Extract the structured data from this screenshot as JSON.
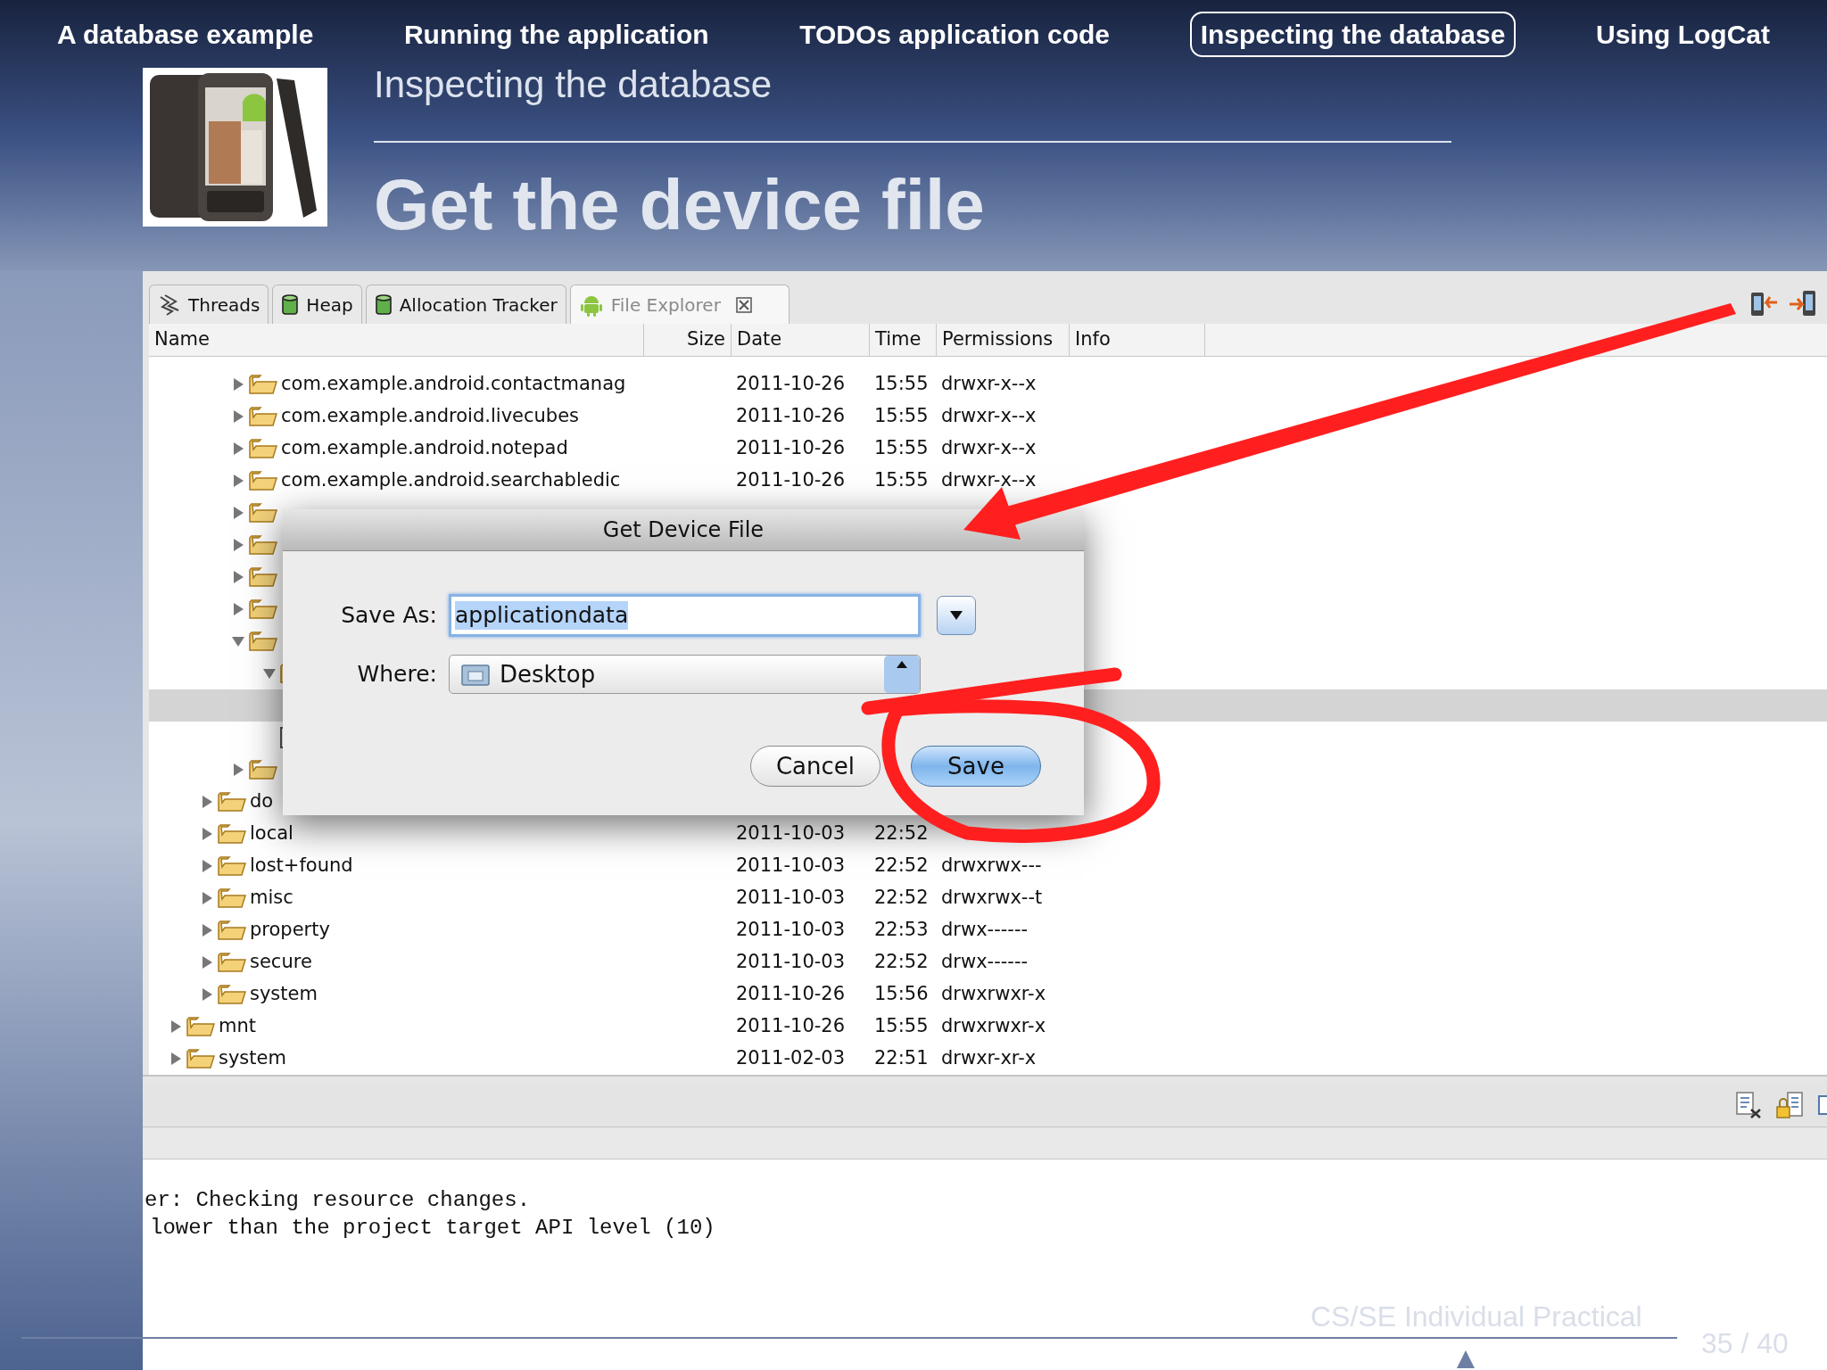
{
  "nav": [
    {
      "label": "A database example",
      "selected": false
    },
    {
      "label": "Running the application",
      "selected": false
    },
    {
      "label": "TODOs application code",
      "selected": false
    },
    {
      "label": "Inspecting the database",
      "selected": true
    },
    {
      "label": "Using LogCat",
      "selected": false
    }
  ],
  "section_title": "Inspecting the database",
  "slide_title": "Get the device file",
  "panel_tabs": [
    {
      "label": "Threads",
      "kind": "threads",
      "selected": false
    },
    {
      "label": "Heap",
      "kind": "heap",
      "selected": false
    },
    {
      "label": "Allocation Tracker",
      "kind": "heap",
      "selected": false
    },
    {
      "label": "File Explorer",
      "kind": "android",
      "selected": true
    }
  ],
  "file_table": {
    "columns": [
      "Name",
      "Size",
      "Date",
      "Time",
      "Permissions",
      "Info"
    ],
    "tree": [
      {
        "children": [
          {
            "children": [
              {
                "name": "com.example.android.contactmanag",
                "date": "2011-10-26",
                "time": "15:55",
                "permissions": "drwxr-x--x",
                "expanded": false,
                "selected": false
              },
              {
                "name": "com.example.android.livecubes",
                "date": "2011-10-26",
                "time": "15:55",
                "permissions": "drwxr-x--x",
                "expanded": false,
                "selected": false
              },
              {
                "name": "com.example.android.notepad",
                "date": "2011-10-26",
                "time": "15:55",
                "permissions": "drwxr-x--x",
                "expanded": false,
                "selected": false
              },
              {
                "name": "com.example.android.searchabledic",
                "date": "2011-10-26",
                "time": "15:55",
                "permissions": "drwxr-x--x",
                "expanded": false,
                "selected": false
              },
              {
                "expanded": false,
                "selected": false
              },
              {
                "expanded": false,
                "selected": false
              },
              {
                "expanded": false,
                "selected": false
              },
              {
                "expanded": false,
                "selected": false
              },
              {
                "expanded": true,
                "selected": false,
                "children": [
                  {
                    "expanded": true,
                    "selected": false,
                    "children": [
                      {
                        "selected": true
                      }
                    ]
                  },
                  {
                    "selected": false
                  }
                ]
              },
              {
                "expanded": false,
                "selected": false
              }
            ]
          },
          {
            "name": "do",
            "expanded": false,
            "selected": false
          },
          {
            "name": "local",
            "date": "2011-10-03",
            "time": "22:52",
            "expanded": false,
            "selected": false
          },
          {
            "name": "lost+found",
            "date": "2011-10-03",
            "time": "22:52",
            "permissions": "drwxrwx---",
            "expanded": false,
            "selected": false
          },
          {
            "name": "misc",
            "date": "2011-10-03",
            "time": "22:52",
            "permissions": "drwxrwx--t",
            "expanded": false,
            "selected": false
          },
          {
            "name": "property",
            "date": "2011-10-03",
            "time": "22:53",
            "permissions": "drwx------",
            "expanded": false,
            "selected": false
          },
          {
            "name": "secure",
            "date": "2011-10-03",
            "time": "22:52",
            "permissions": "drwx------",
            "expanded": false,
            "selected": false
          },
          {
            "name": "system",
            "date": "2011-10-26",
            "time": "15:56",
            "permissions": "drwxrwxr-x",
            "expanded": false,
            "selected": false
          }
        ]
      },
      {
        "name": "mnt",
        "date": "2011-10-26",
        "time": "15:55",
        "permissions": "drwxrwxr-x",
        "expanded": false,
        "selected": false
      },
      {
        "name": "system",
        "date": "2011-02-03",
        "time": "22:51",
        "permissions": "drwxr-xr-x",
        "expanded": false,
        "selected": false
      }
    ]
  },
  "dialog": {
    "title": "Get Device File",
    "save_as_label": "Save As:",
    "save_as_value": "applicationdata",
    "where_label": "Where:",
    "where_value": "Desktop",
    "buttons": [
      {
        "label": "Cancel",
        "default": false
      },
      {
        "label": "Save",
        "default": true
      }
    ]
  },
  "console": {
    "lines": [
      "er: Checking resource changes.",
      "lower than the project target API level (10)"
    ]
  },
  "footer": {
    "title": "CS/SE Individual Practical",
    "page": "35 / 40"
  }
}
